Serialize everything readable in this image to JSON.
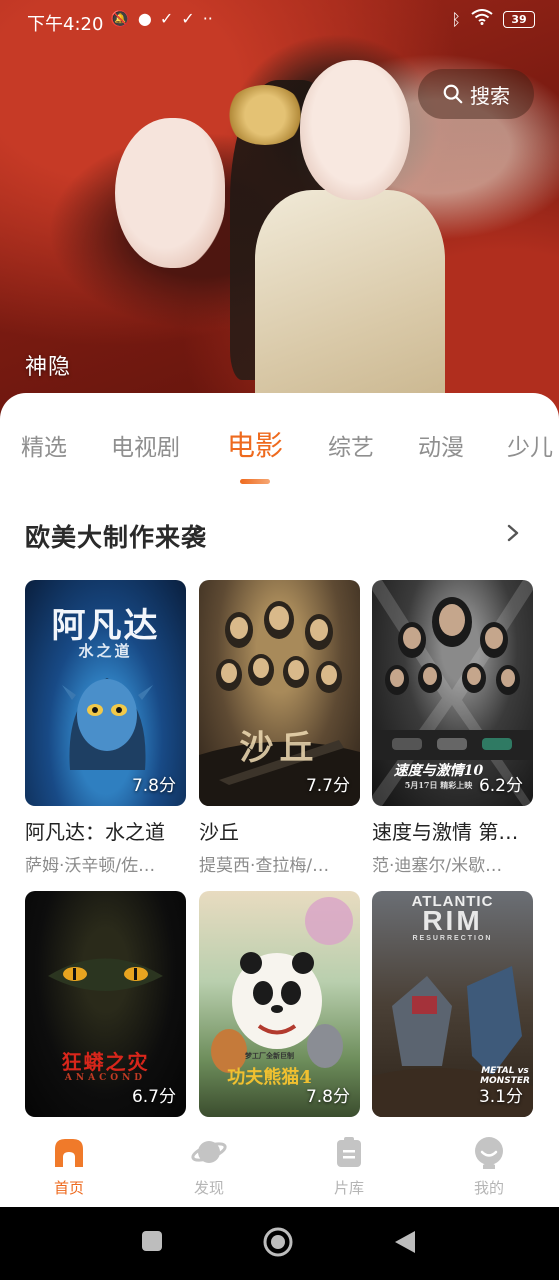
{
  "status_bar": {
    "time": "下午4:20",
    "battery": "39"
  },
  "hero": {
    "title": "神隐",
    "search_label": "搜索"
  },
  "tabs": [
    {
      "label": "精选"
    },
    {
      "label": "电视剧"
    },
    {
      "label": "电影"
    },
    {
      "label": "综艺"
    },
    {
      "label": "动漫"
    },
    {
      "label": "少儿"
    }
  ],
  "section": {
    "title": "欧美大制作来袭"
  },
  "movies": [
    {
      "title": "阿凡达：水之道",
      "cast": "萨姆·沃辛顿/佐…",
      "rating": "7.8分",
      "poster_text": "阿凡达",
      "poster_sub": "水之道"
    },
    {
      "title": "沙丘",
      "cast": "提莫西·查拉梅/…",
      "rating": "7.7分",
      "poster_text": "沙丘"
    },
    {
      "title": "速度与激情 第…",
      "cast": "范·迪塞尔/米歇…",
      "rating": "6.2分",
      "poster_text": "速度与激情10",
      "poster_sub": "5月17日 精彩上映"
    },
    {
      "title": "",
      "cast": "",
      "rating": "6.7分",
      "poster_text": "狂蟒之灾",
      "poster_sub": "ANACOND"
    },
    {
      "title": "",
      "cast": "",
      "rating": "7.8分",
      "poster_text": "功夫熊猫4",
      "poster_sub": "梦工厂全新巨制"
    },
    {
      "title": "",
      "cast": "",
      "rating": "3.1分",
      "poster_text": "RIM",
      "poster_top": "ATLANTIC",
      "poster_sub": "RESURRECTION",
      "poster_corner": "METAL vs MONSTER"
    }
  ],
  "bottom_nav": [
    {
      "label": "首页",
      "icon": "home-icon",
      "active": true
    },
    {
      "label": "发现",
      "icon": "planet-icon",
      "active": false
    },
    {
      "label": "片库",
      "icon": "library-icon",
      "active": false
    },
    {
      "label": "我的",
      "icon": "profile-icon",
      "active": false
    }
  ],
  "colors": {
    "accent": "#ee6a1e",
    "inactive": "#b5b5b5"
  }
}
